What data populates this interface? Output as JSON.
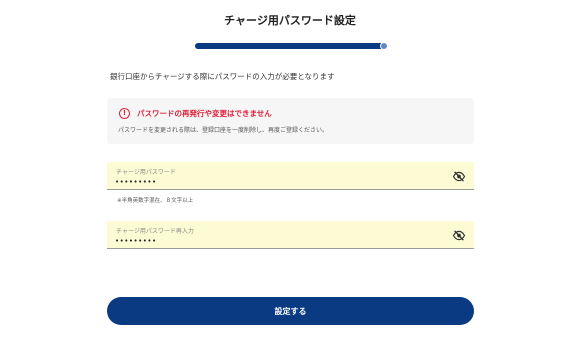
{
  "header": {
    "title": "チャージ用パスワード設定"
  },
  "progress": {
    "value": 1.0
  },
  "description": "銀行口座からチャージする際にパスワードの入力が必要となります",
  "notice": {
    "icon": "alert-circle-icon",
    "icon_glyph": "!",
    "title": "パスワードの再発行や変更はできません",
    "body": "パスワードを変更される際は、登録口座を一度削除し、再度ご登録ください。",
    "color": "#e0203a"
  },
  "password_field": {
    "label": "チャージ用パスワード",
    "value": "•••••••••",
    "icon": "eye-off-icon"
  },
  "password_hint": "※半角英数字混在、８文字以上",
  "confirm_field": {
    "label": "チャージ用パスワード再入力",
    "value": "•••••••••",
    "icon": "eye-off-icon"
  },
  "submit": {
    "label": "設定する"
  },
  "colors": {
    "primary": "#0a3a82",
    "field_background": "#fdfbd3",
    "error": "#e0203a"
  }
}
